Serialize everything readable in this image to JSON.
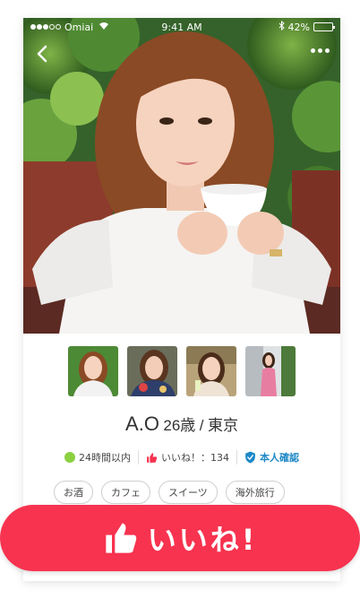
{
  "status_bar": {
    "carrier": "Omiai",
    "time": "9:41 AM",
    "battery": "42%",
    "battery_level": 0.42
  },
  "profile": {
    "name": "A.O",
    "age": "26歳",
    "separator": "/",
    "location": "東京"
  },
  "stats": {
    "login": "24時間以内",
    "likes": "いいね！：134",
    "verified": "本人確認"
  },
  "tags": [
    "お酒",
    "カフェ",
    "スイーツ",
    "海外旅行"
  ],
  "like_button": {
    "label": "いいね!"
  },
  "colors": {
    "accent": "#f7334f",
    "online": "#8bd13f",
    "verified": "#1e88c7"
  },
  "icons": [
    "back-icon",
    "more-icon",
    "wifi-icon",
    "bluetooth-icon",
    "battery-icon",
    "thumbs-up-icon",
    "verified-shield-icon"
  ]
}
